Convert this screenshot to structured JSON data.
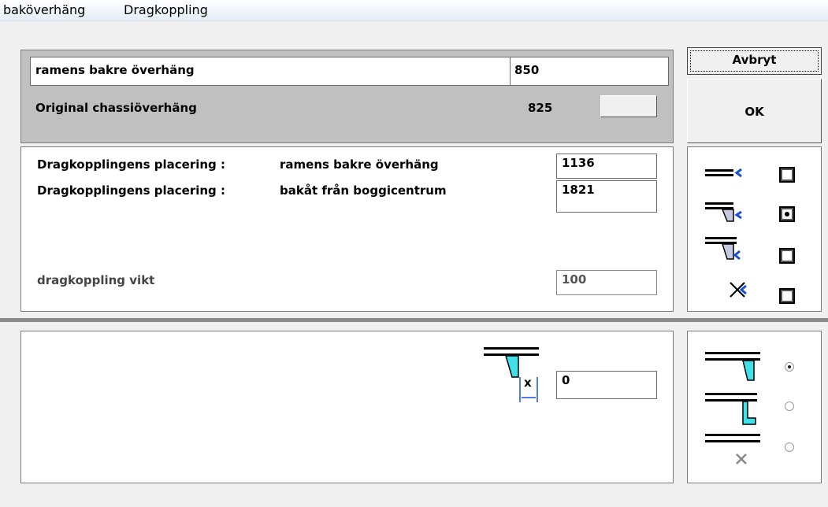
{
  "menu": {
    "item1": "baköverhäng",
    "item2": "Dragkoppling"
  },
  "overhang": {
    "label": "ramens bakre överhäng",
    "value": "850",
    "original_label": "Original chassiöverhäng",
    "original_value": "825"
  },
  "buttons": {
    "cancel": "Avbryt",
    "ok": "OK"
  },
  "coupling": {
    "row1_label": "Dragkopplingens placering :",
    "row1_desc": "ramens bakre överhäng",
    "row1_value": "1136",
    "row2_label": "Dragkopplingens placering :",
    "row2_desc": "bakåt från boggicentrum",
    "row2_value": "1821",
    "weight_label": "dragkoppling vikt",
    "weight_value": "100"
  },
  "coupling_types": {
    "selected_index": 1
  },
  "bottom": {
    "x_label": "x",
    "x_value": "0"
  },
  "bracket_types": {
    "selected_index": 0
  },
  "colors": {
    "accent_cyan": "#40e0e8",
    "arrow_blue": "#1a4fd8"
  }
}
